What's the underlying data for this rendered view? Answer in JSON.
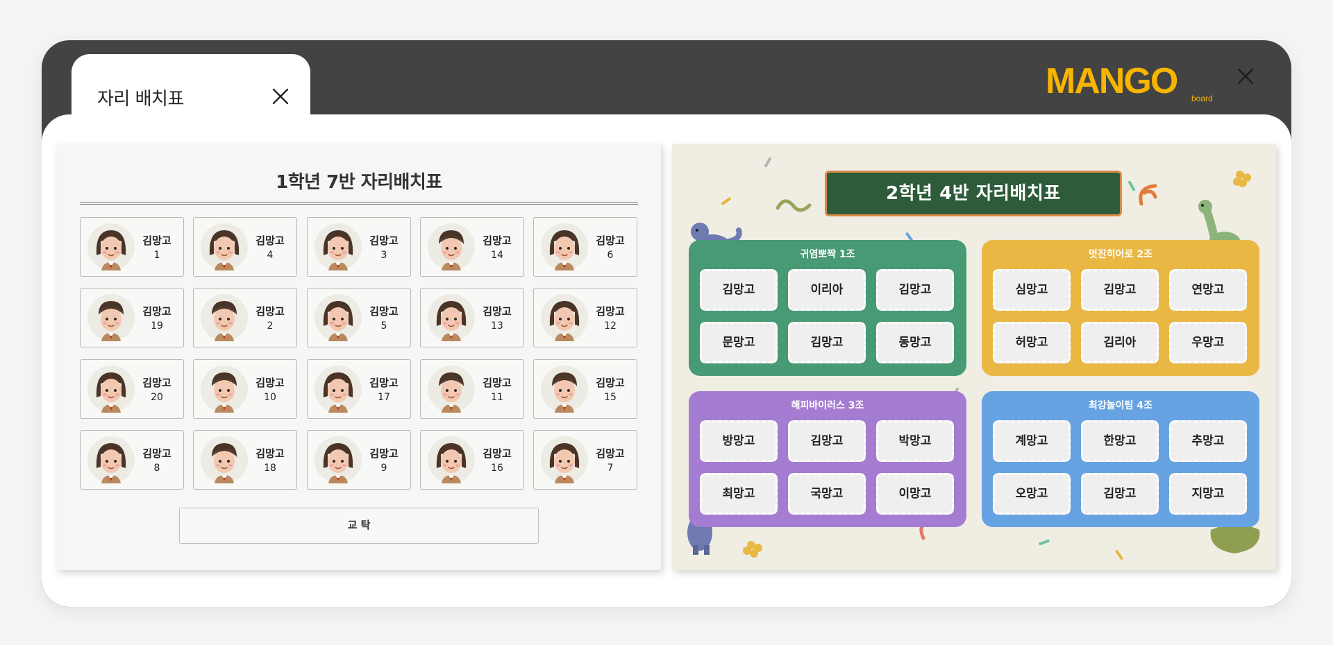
{
  "tab": {
    "title": "자리 배치표"
  },
  "logo": {
    "text": "MANGO",
    "sub": "board",
    "color": "#F7B500"
  },
  "left": {
    "title": "1학년 7반  자리배치표",
    "seats": [
      {
        "name": "김망고",
        "num": "1"
      },
      {
        "name": "김망고",
        "num": "4"
      },
      {
        "name": "김망고",
        "num": "3"
      },
      {
        "name": "김망고",
        "num": "14"
      },
      {
        "name": "김망고",
        "num": "6"
      },
      {
        "name": "김망고",
        "num": "19"
      },
      {
        "name": "김망고",
        "num": "2"
      },
      {
        "name": "김망고",
        "num": "5"
      },
      {
        "name": "김망고",
        "num": "13"
      },
      {
        "name": "김망고",
        "num": "12"
      },
      {
        "name": "김망고",
        "num": "20"
      },
      {
        "name": "김망고",
        "num": "10"
      },
      {
        "name": "김망고",
        "num": "17"
      },
      {
        "name": "김망고",
        "num": "11"
      },
      {
        "name": "김망고",
        "num": "15"
      },
      {
        "name": "김망고",
        "num": "8"
      },
      {
        "name": "김망고",
        "num": "18"
      },
      {
        "name": "김망고",
        "num": "9"
      },
      {
        "name": "김망고",
        "num": "16"
      },
      {
        "name": "김망고",
        "num": "7"
      }
    ],
    "desk": "교 탁"
  },
  "right": {
    "title": "2학년 4반  자리배치표",
    "groups": [
      {
        "name": "귀염뽀짝 1조",
        "color": "#479a73",
        "members": [
          "김망고",
          "이리아",
          "김망고",
          "문망고",
          "김망고",
          "동망고"
        ]
      },
      {
        "name": "멋진히어로 2조",
        "color": "#e9b844",
        "members": [
          "심망고",
          "김망고",
          "연망고",
          "허망고",
          "김리아",
          "우망고"
        ]
      },
      {
        "name": "해피바이러스 3조",
        "color": "#a47cd2",
        "members": [
          "방망고",
          "김망고",
          "박망고",
          "최망고",
          "국망고",
          "이망고"
        ]
      },
      {
        "name": "최강놀이팀 4조",
        "color": "#67a3e2",
        "members": [
          "계망고",
          "한망고",
          "추망고",
          "오망고",
          "김망고",
          "지망고"
        ]
      }
    ]
  }
}
